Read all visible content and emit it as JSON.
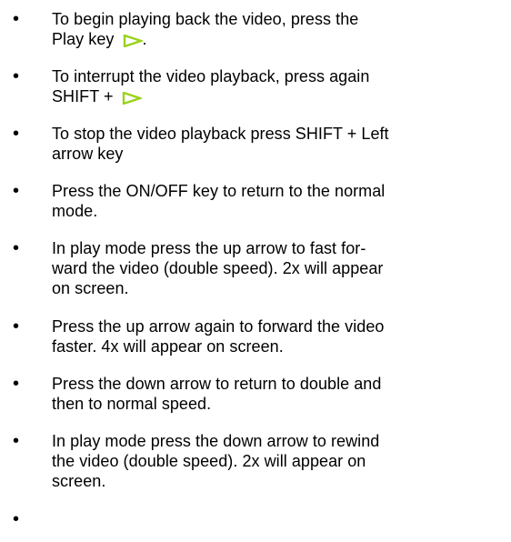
{
  "icons": {
    "play": "play-key-icon",
    "play_color": "#9ad21c",
    "bullet": "•"
  },
  "items": [
    {
      "lines": [
        "To begin playing back the video, press the",
        "Play key"
      ],
      "suffix": "."
    },
    {
      "lines": [
        "To interrupt the video playback, press again",
        "SHIFT +"
      ],
      "suffix": ""
    },
    {
      "lines": [
        "To stop the video playback press SHIFT + Left",
        "arrow key"
      ]
    },
    {
      "lines": [
        "Press the ON/OFF key to return to the normal",
        "mode."
      ]
    },
    {
      "lines": [
        "In play mode press the up arrow to fast for-",
        "ward the video (double speed). 2x will appear",
        "on screen."
      ]
    },
    {
      "lines": [
        "Press the up arrow again to forward the video",
        "faster. 4x will appear on screen."
      ]
    },
    {
      "lines": [
        "Press the down arrow to return to double and",
        "then to normal speed."
      ]
    },
    {
      "lines": [
        "In play mode press the down arrow to rewind",
        "the video (double speed). 2x will appear on",
        "screen."
      ]
    },
    {
      "lines": []
    }
  ]
}
